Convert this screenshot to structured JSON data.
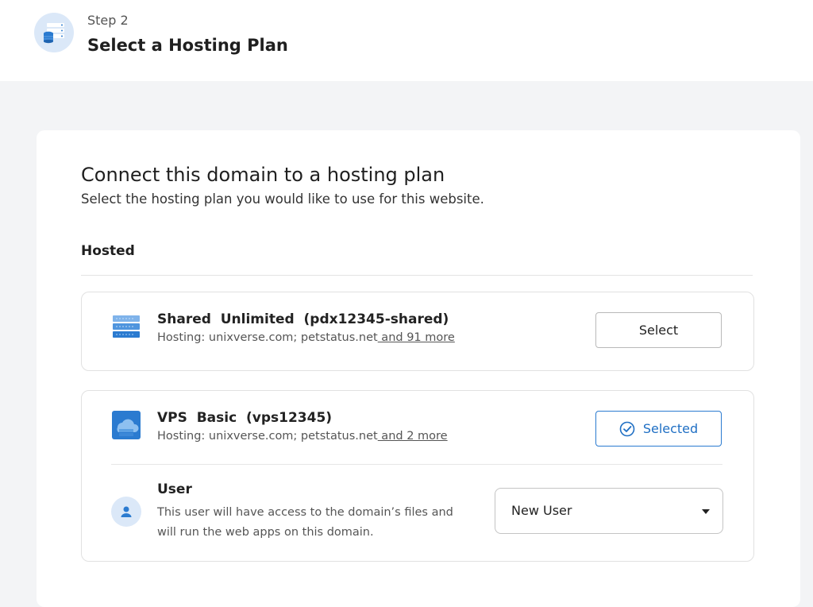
{
  "header": {
    "step_label": "Step 2",
    "title": "Select a Hosting Plan",
    "icon": "server-database-icon"
  },
  "main": {
    "title": "Connect this domain to a hosting plan",
    "subtitle": "Select the hosting plan you would like to use for this website.",
    "section_label": "Hosted",
    "plans": [
      {
        "name": "Shared  Unlimited  (pdx12345-shared)",
        "hosting_prefix": "Hosting: unixverse.com; petstatus.net",
        "more_link": " and 91 more",
        "button_label": "Select",
        "selected": false,
        "icon": "shared-server-icon"
      },
      {
        "name": "VPS  Basic  (vps12345)",
        "hosting_prefix": "Hosting: unixverse.com; petstatus.net",
        "more_link": " and 2 more",
        "button_label": "Selected",
        "selected": true,
        "icon": "cloud-server-icon"
      }
    ],
    "user": {
      "title": "User",
      "description": "This user will have access to the domain’s files and will run the web apps on this domain.",
      "select_value": "New User",
      "icon": "user-icon"
    }
  },
  "colors": {
    "page_bg": "#f3f4f6",
    "accent": "#1f6fc4",
    "icon_bg": "#dbe8f8"
  }
}
